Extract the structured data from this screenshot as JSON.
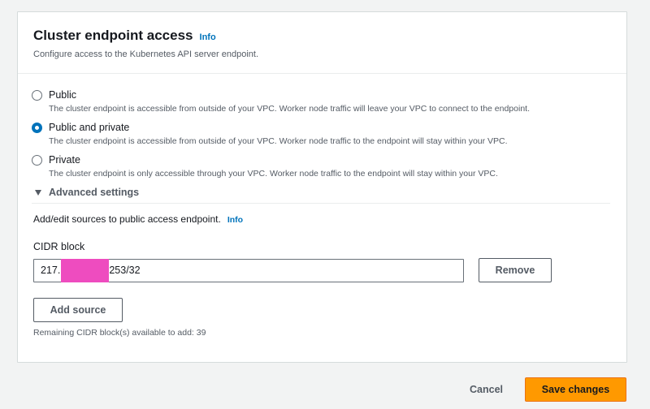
{
  "section": {
    "title": "Cluster endpoint access",
    "info_label": "Info",
    "description": "Configure access to the Kubernetes API server endpoint."
  },
  "options": [
    {
      "label": "Public",
      "description": "The cluster endpoint is accessible from outside of your VPC. Worker node traffic will leave your VPC to connect to the endpoint.",
      "selected": false
    },
    {
      "label": "Public and private",
      "description": "The cluster endpoint is accessible from outside of your VPC. Worker node traffic to the endpoint will stay within your VPC.",
      "selected": true
    },
    {
      "label": "Private",
      "description": "The cluster endpoint is only accessible through your VPC. Worker node traffic to the endpoint will stay within your VPC.",
      "selected": false
    }
  ],
  "advanced": {
    "toggle_label": "Advanced settings",
    "sources_text": "Add/edit sources to public access endpoint.",
    "sources_info": "Info",
    "cidr_label": "CIDR block",
    "cidr_prefix": "217.",
    "cidr_suffix": "253/32",
    "remove_label": "Remove",
    "add_source_label": "Add source",
    "remaining_text": "Remaining CIDR block(s) available to add: 39"
  },
  "footer": {
    "cancel_label": "Cancel",
    "save_label": "Save changes"
  },
  "colors": {
    "accent": "#0073bb",
    "primary_button": "#ff9900",
    "redaction": "#ee4cbf"
  }
}
